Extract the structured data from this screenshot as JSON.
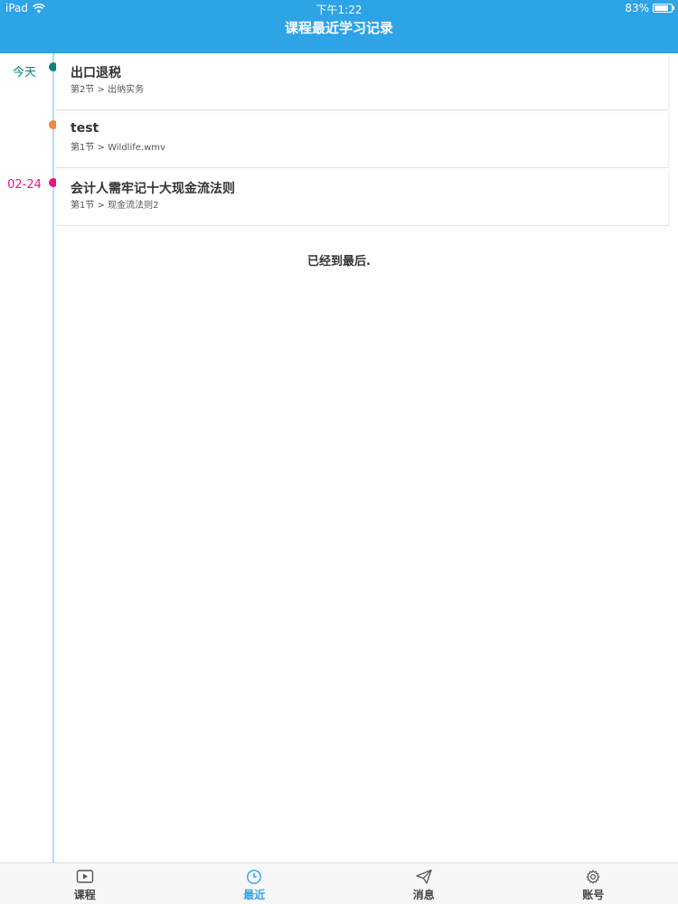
{
  "status_bar": {
    "device": "iPad",
    "time": "下午1:22",
    "battery": "83%",
    "battery_level": 0.83
  },
  "nav": {
    "title": "课程最近学习记录"
  },
  "records": [
    {
      "date": "今天",
      "dot_color": "#14807a",
      "date_color": "#14807a",
      "title": "出口退税",
      "subtitle": "第2节 > 出纳实务"
    },
    {
      "date": "",
      "dot_color": "#f08a3c",
      "date_color": "#f08a3c",
      "title": "test",
      "subtitle": "第1节 > Wildlife.wmv"
    },
    {
      "date": "02-24",
      "dot_color": "#e8177a",
      "date_color": "#e8177a",
      "title": "会计人需牢记十大现金流法则",
      "subtitle": "第1节 > 现金流法则2"
    }
  ],
  "end_message": "已经到最后.",
  "tabbar": {
    "active_color": "#2ea3e6",
    "tabs": [
      {
        "label": "课程",
        "icon": "play-icon",
        "active": false
      },
      {
        "label": "最近",
        "icon": "clock-icon",
        "active": true
      },
      {
        "label": "消息",
        "icon": "paper-plane-icon",
        "active": false
      },
      {
        "label": "账号",
        "icon": "gear-icon",
        "active": false
      }
    ]
  }
}
